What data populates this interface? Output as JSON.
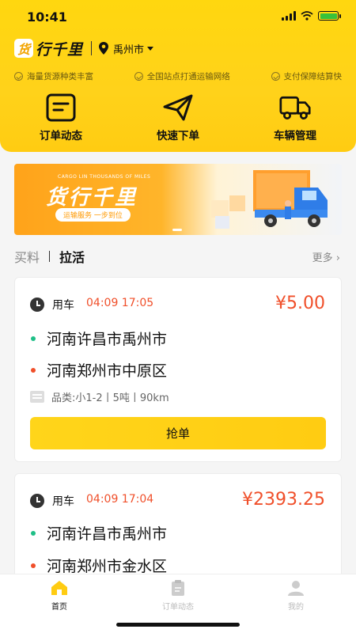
{
  "status_bar": {
    "time": "10:41"
  },
  "header": {
    "brand": {
      "mark": "货",
      "name": "行千里"
    },
    "location": {
      "city": "禹州市"
    },
    "features": [
      {
        "label": "海量货源种类丰富"
      },
      {
        "label": "全国站点打通运输网络"
      },
      {
        "label": "支付保障结算快"
      }
    ],
    "quick_actions": [
      {
        "label": "订单动态",
        "icon": "document-icon"
      },
      {
        "label": "快速下单",
        "icon": "paper-plane-icon"
      },
      {
        "label": "车辆管理",
        "icon": "truck-icon"
      }
    ]
  },
  "banner": {
    "small_text": "CARGO LIN THOUSANDS OF MILES",
    "title": "货行千里",
    "slogan": "运输服务 一步到位"
  },
  "section": {
    "tabs": [
      "买料",
      "拉活"
    ],
    "active_tab": "拉活",
    "more": "更多"
  },
  "orders": [
    {
      "use_label": "用车",
      "time": "04:09 17:05",
      "price": "¥5.00",
      "from": "河南许昌市禹州市",
      "to": "河南郑州市中原区",
      "cargo": "品类:小1-2丨5吨丨90km",
      "action": "抢单"
    },
    {
      "use_label": "用车",
      "time": "04:09 17:04",
      "price": "¥2393.25",
      "from": "河南许昌市禹州市",
      "to": "河南郑州市金水区"
    }
  ],
  "bottom_nav": [
    {
      "label": "首页",
      "icon": "home-icon",
      "active": true
    },
    {
      "label": "订单动态",
      "icon": "clipboard-icon",
      "active": false
    },
    {
      "label": "我的",
      "icon": "user-icon",
      "active": false
    }
  ],
  "colors": {
    "brand_yellow": "#FFD20F",
    "accent_red": "#F04F2A",
    "accent_green": "#1FBF87"
  }
}
